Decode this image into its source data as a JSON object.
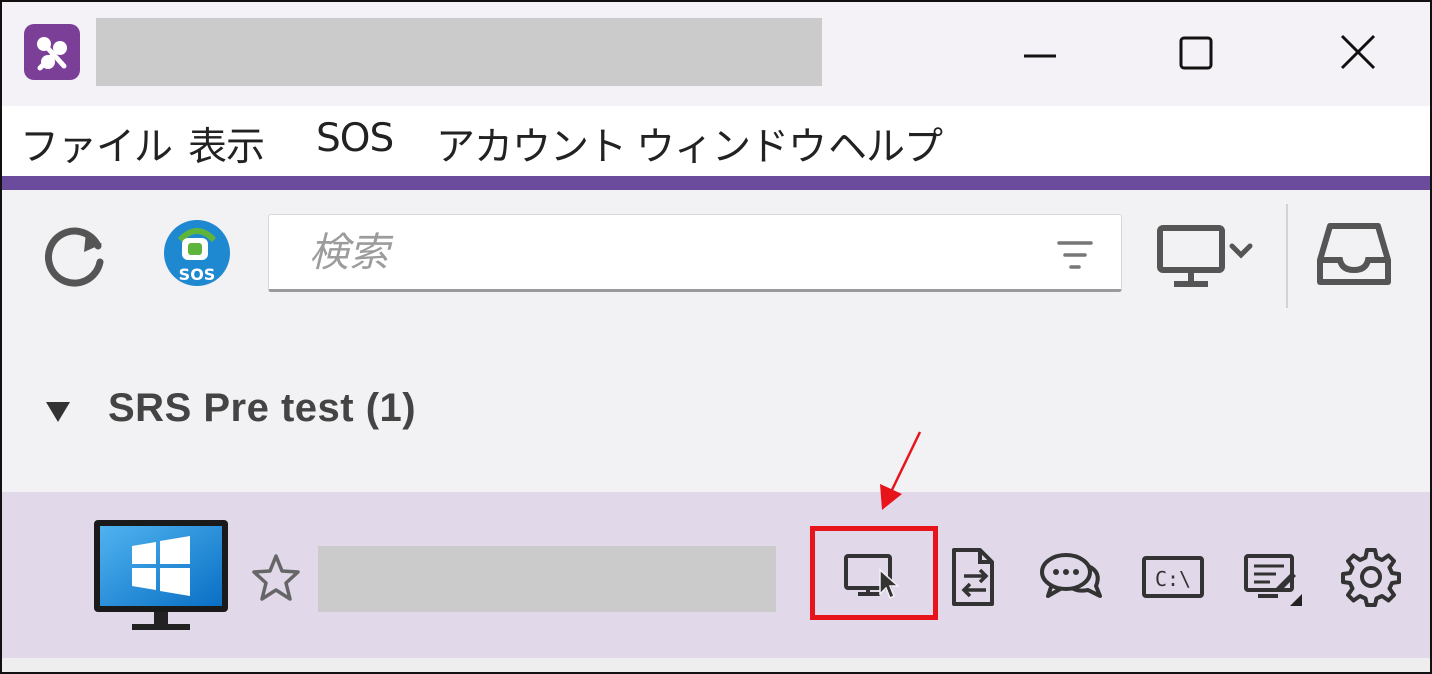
{
  "window": {
    "title": "",
    "controls": {
      "minimize": "minimize-icon",
      "maximize": "maximize-icon",
      "close": "close-icon"
    }
  },
  "menu": {
    "items": [
      {
        "label": "ファイル"
      },
      {
        "label": "表示"
      },
      {
        "label": "SOS"
      },
      {
        "label": "アカウント"
      },
      {
        "label": "ウィンドウ"
      },
      {
        "label": "ヘルプ"
      }
    ]
  },
  "toolbar": {
    "refresh_icon": "refresh-icon",
    "sos_label": "SOS",
    "search": {
      "placeholder": "検索",
      "value": ""
    },
    "filter_icon": "filter-icon",
    "computer_dropdown_icon": "monitor-icon",
    "inbox_icon": "inbox-icon"
  },
  "group": {
    "toggle_icon": "triangle-down-icon",
    "title": "SRS Pre test (1)"
  },
  "device": {
    "name": "",
    "os_icon": "windows-pc-icon",
    "actions": [
      {
        "name": "remote-control",
        "icon": "remote-control-icon"
      },
      {
        "name": "file-transfer",
        "icon": "file-transfer-icon"
      },
      {
        "name": "chat",
        "icon": "chat-icon"
      },
      {
        "name": "command-prompt",
        "icon": "command-prompt-icon",
        "label": "C:\\"
      },
      {
        "name": "remote-tools",
        "icon": "remote-tools-icon"
      },
      {
        "name": "settings",
        "icon": "gear-icon"
      }
    ]
  },
  "colors": {
    "accent": "#6a4b9c",
    "logo": "#7c3f98",
    "row_highlight": "#e1d8ea",
    "annotation": "#e8141c",
    "sos_blue": "#1e88d0",
    "sos_green": "#5fb43c"
  }
}
